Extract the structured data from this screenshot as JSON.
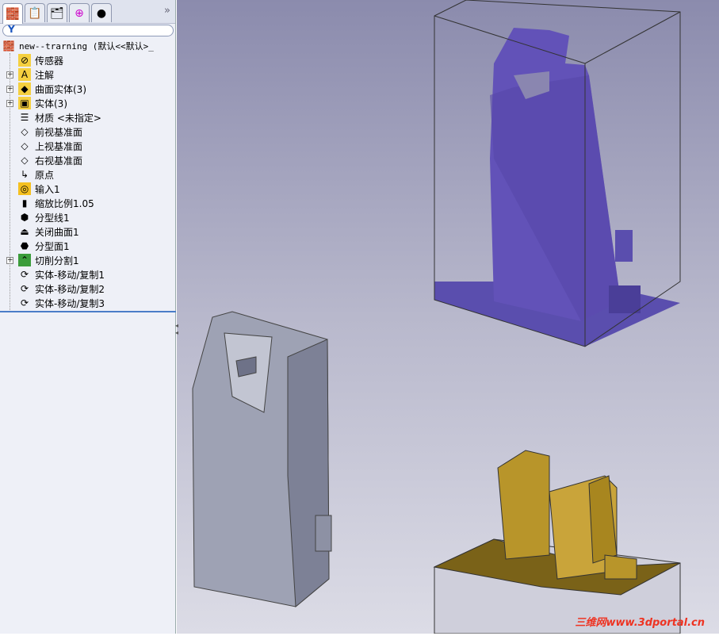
{
  "panel": {
    "tabs": [
      {
        "icon": "feature-manager-icon"
      },
      {
        "icon": "property-manager-icon"
      },
      {
        "icon": "configuration-manager-icon"
      },
      {
        "icon": "dimxpert-icon"
      },
      {
        "icon": "appearance-icon"
      }
    ],
    "more": "»",
    "root": "new--trarning  (默认<<默认>_",
    "items": [
      {
        "label": "传感器",
        "icon": "sensor-folder-icon",
        "expandable": false
      },
      {
        "label": "注解",
        "icon": "annotation-folder-icon",
        "expandable": true
      },
      {
        "label": "曲面实体(3)",
        "icon": "surface-bodies-folder-icon",
        "expandable": true
      },
      {
        "label": "实体(3)",
        "icon": "solid-bodies-folder-icon",
        "expandable": true
      },
      {
        "label": "材质 <未指定>",
        "icon": "material-icon",
        "expandable": false
      },
      {
        "label": "前视基准面",
        "icon": "plane-icon",
        "expandable": false
      },
      {
        "label": "上视基准面",
        "icon": "plane-icon",
        "expandable": false
      },
      {
        "label": "右视基准面",
        "icon": "plane-icon",
        "expandable": false
      },
      {
        "label": "原点",
        "icon": "origin-icon",
        "expandable": false
      },
      {
        "label": "输入1",
        "icon": "import-icon",
        "expandable": false
      },
      {
        "label": "缩放比例1.05",
        "icon": "scale-icon",
        "expandable": false
      },
      {
        "label": "分型线1",
        "icon": "parting-line-icon",
        "expandable": false
      },
      {
        "label": "关闭曲面1",
        "icon": "shut-off-surface-icon",
        "expandable": false
      },
      {
        "label": "分型面1",
        "icon": "parting-surface-icon",
        "expandable": false
      },
      {
        "label": "切削分割1",
        "icon": "tooling-split-icon",
        "expandable": true
      },
      {
        "label": "实体-移动/复制1",
        "icon": "move-copy-body-icon",
        "expandable": false
      },
      {
        "label": "实体-移动/复制2",
        "icon": "move-copy-body-icon",
        "expandable": false
      },
      {
        "label": "实体-移动/复制3",
        "icon": "move-copy-body-icon",
        "expandable": false
      }
    ]
  },
  "viewport": {
    "watermark": "三维网www.3dportal.cn",
    "colors": {
      "part": "#9ea2b4",
      "core": "#5b4fb0",
      "cavity": "#b8952a"
    }
  }
}
